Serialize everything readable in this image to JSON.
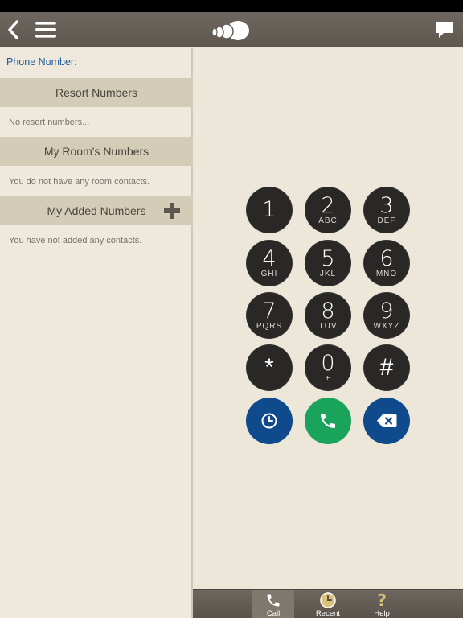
{
  "navbar": {
    "back_icon": "chevron-left-icon",
    "menu_icon": "hamburger-menu-icon",
    "logo_icon": "shell-logo-icon",
    "chat_icon": "speech-bubble-icon"
  },
  "sidebar": {
    "phone_number_label": "Phone Number:",
    "sections": [
      {
        "title": "Resort Numbers",
        "empty_text": "No resort numbers..."
      },
      {
        "title": "My Room's Numbers",
        "empty_text": "You do not have any room contacts."
      },
      {
        "title": "My Added Numbers",
        "empty_text": "You have not added any contacts."
      }
    ]
  },
  "keypad": {
    "keys": [
      {
        "digit": "1",
        "letters": ""
      },
      {
        "digit": "2",
        "letters": "ABC"
      },
      {
        "digit": "3",
        "letters": "DEF"
      },
      {
        "digit": "4",
        "letters": "GHI"
      },
      {
        "digit": "5",
        "letters": "JKL"
      },
      {
        "digit": "6",
        "letters": "MNO"
      },
      {
        "digit": "7",
        "letters": "PQRS"
      },
      {
        "digit": "8",
        "letters": "TUV"
      },
      {
        "digit": "9",
        "letters": "WXYZ"
      },
      {
        "digit": "*",
        "letters": ""
      },
      {
        "digit": "0",
        "letters": "+"
      },
      {
        "digit": "#",
        "letters": ""
      }
    ],
    "actions": {
      "recent_icon": "clock-icon",
      "call_icon": "phone-icon",
      "delete_icon": "backspace-icon"
    }
  },
  "tabbar": {
    "tabs": [
      {
        "label": "Call",
        "icon": "phone-icon",
        "active": true
      },
      {
        "label": "Recent",
        "icon": "clock-icon",
        "active": false
      },
      {
        "label": "Help",
        "icon": "question-icon",
        "active": false
      }
    ]
  },
  "colors": {
    "navbar": "#655e56",
    "section_header": "#d3ccb7",
    "key": "#2a2826",
    "recent_button": "#0f4a8c",
    "call_button": "#1aa35a",
    "delete_button": "#0f4a8c",
    "link_blue": "#1f5a96"
  }
}
